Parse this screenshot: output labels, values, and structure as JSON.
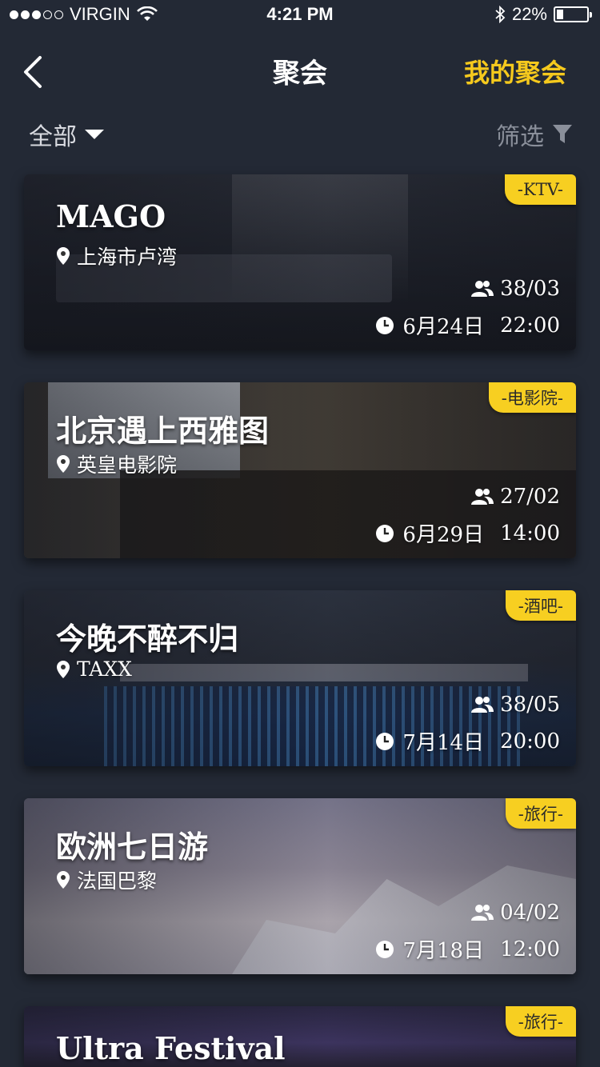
{
  "status_bar": {
    "carrier": "VIRGIN",
    "time": "4:21 PM",
    "battery": "22%",
    "battery_level": 0.22
  },
  "nav": {
    "title": "聚会",
    "right_label": "我的聚会",
    "accent_color": "#f5c91d"
  },
  "filter": {
    "category": "全部",
    "screen_label": "筛选"
  },
  "cards": [
    {
      "tag": "-KTV-",
      "title": "MAGO",
      "location": "上海市卢湾",
      "people": "38/03",
      "date": "6月24日",
      "time": "22:00"
    },
    {
      "tag": "-电影院-",
      "title": "北京遇上西雅图",
      "location": "英皇电影院",
      "people": "27/02",
      "date": "6月29日",
      "time": "14:00"
    },
    {
      "tag": "-酒吧-",
      "title": "今晚不醉不归",
      "location": "TAXX",
      "people": "38/05",
      "date": "7月14日",
      "time": "20:00"
    },
    {
      "tag": "-旅行-",
      "title": "欧洲七日游",
      "location": "法国巴黎",
      "people": "04/02",
      "date": "7月18日",
      "time": "12:00"
    },
    {
      "tag": "-旅行-",
      "title": "Ultra Festival"
    }
  ],
  "tag_color": "#f7cf21",
  "icons": {
    "back": "chevron-left-icon",
    "dropdown": "caret-down-icon",
    "filter": "funnel-icon",
    "location": "map-pin-icon",
    "people": "group-icon",
    "clock": "clock-icon"
  }
}
